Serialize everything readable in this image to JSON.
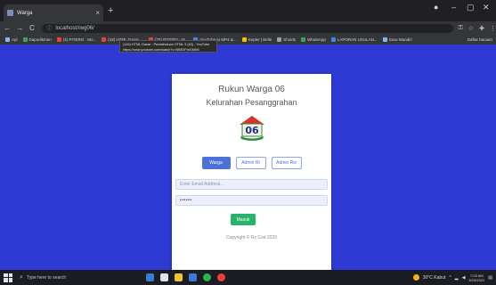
{
  "browser": {
    "tab_title": "Warga",
    "tab_close": "×",
    "new_tab": "+",
    "url": "localhost/rwg06/",
    "nav": {
      "back": "←",
      "forward": "→",
      "reload": "C"
    },
    "bookmarks": [
      {
        "label": "Apl",
        "color": "#8ab4f8"
      },
      {
        "label": "Dapodikmen",
        "color": "#34a853"
      },
      {
        "label": "(4) PITERO · Mo...",
        "color": "#ea4335"
      },
      {
        "label": "(18) HTML Dasar ...",
        "color": "#ea4335"
      },
      {
        "label": "(75) PITERO · M...",
        "color": "#ea4335"
      },
      {
        "label": "YouTube to MP4 &...",
        "color": "#4285f4"
      },
      {
        "label": "Kepler | Belle",
        "color": "#fbbc04"
      },
      {
        "label": "Shinds",
        "color": "#9aa0a6"
      },
      {
        "label": "WhatsApp",
        "color": "#34a853"
      },
      {
        "label": "LAPORAN USULAN...",
        "color": "#4285f4"
      },
      {
        "label": "Stow Mandiri",
        "color": "#8ab4f8"
      }
    ],
    "bookmark_other": "Daftar bacaan",
    "tooltip_line1": "(145) HTML Dasar : Pendahuluan HTML 3 (#2) - YouTube",
    "tooltip_line2": "https://www.youtube.com/watch?v=NBE0FIeGMN0"
  },
  "login": {
    "title_line1": "Rukun Warga 06",
    "title_line2": "Kelurahan Pesanggrahan",
    "logo_text": "06",
    "roles": [
      "Warga",
      "Admin Rt",
      "Admin Rw"
    ],
    "email_placeholder": "Enter Email Address...",
    "password_value": "••••••",
    "submit_label": "Masuk",
    "copyright": "Copyright © Rz Cod 2020"
  },
  "colors": {
    "page_bg": "#2f3ad4",
    "primary": "#4a72d8",
    "success": "#26b36b"
  },
  "taskbar": {
    "search_placeholder": "Type here to search",
    "weather": "30°C Kabut",
    "time": "7:03 AM",
    "date": "6/15/2021"
  }
}
